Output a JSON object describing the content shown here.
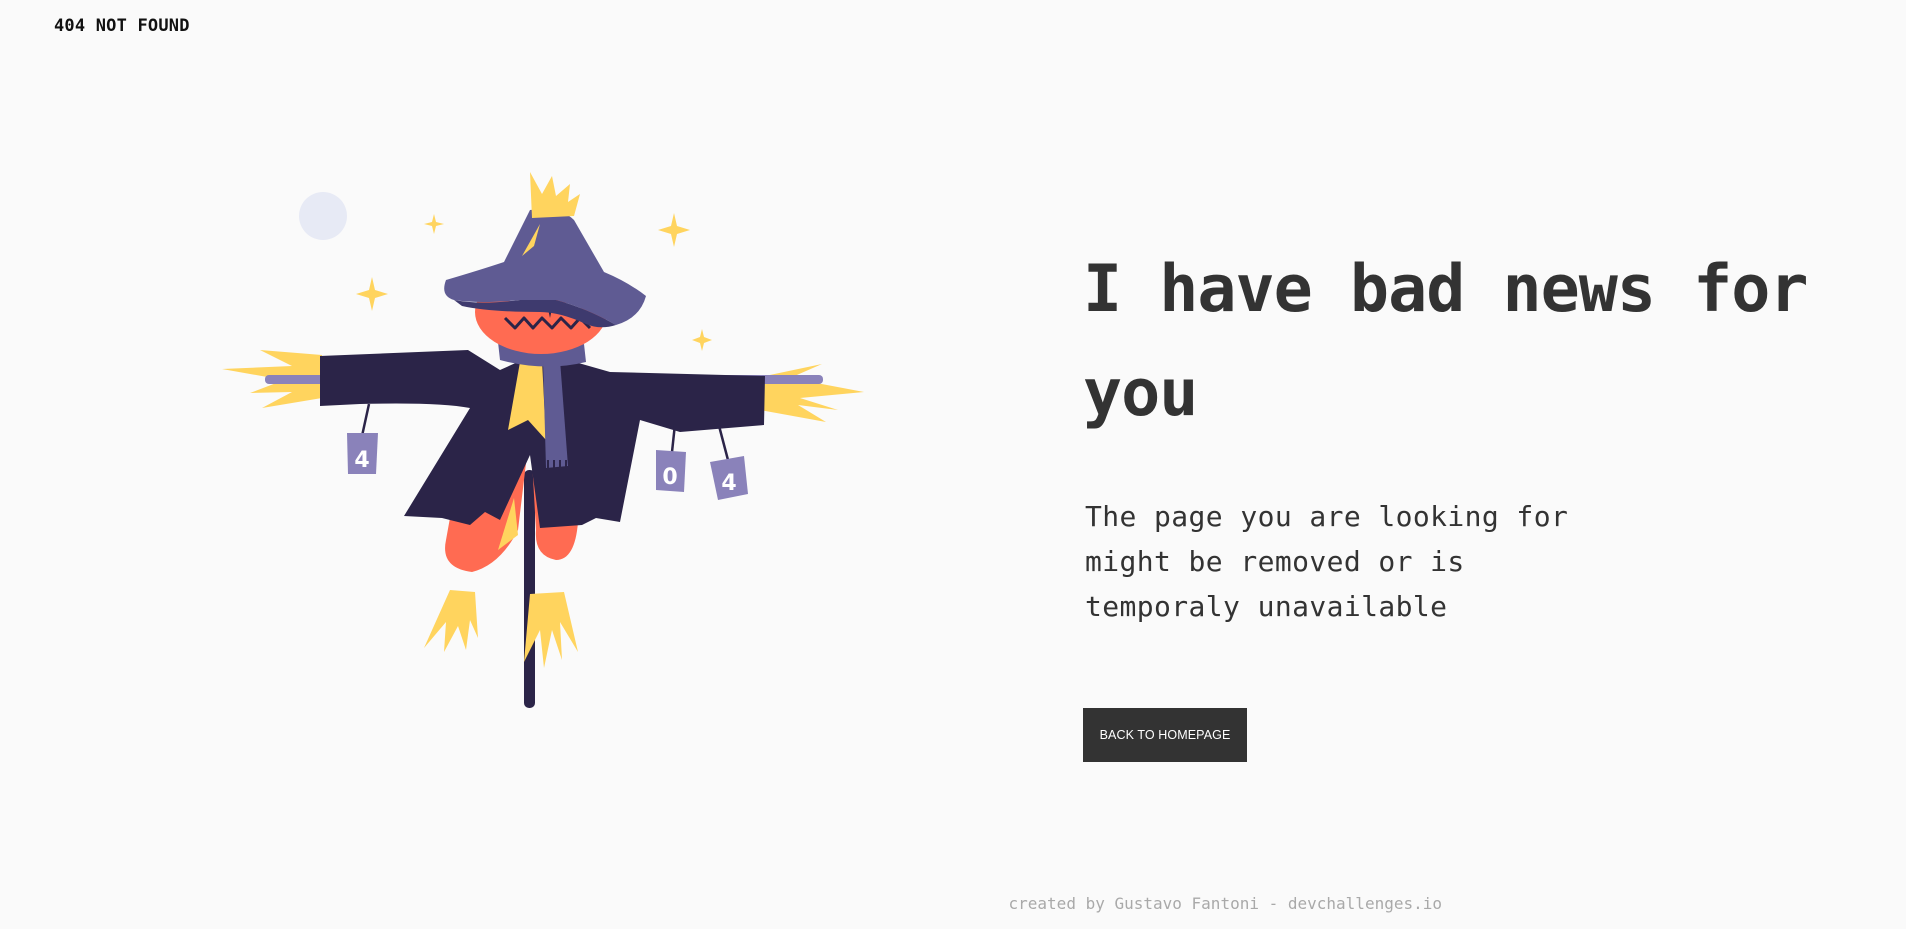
{
  "header": {
    "brand": "404 NOT FOUND"
  },
  "illustration": {
    "name": "scarecrow-illustration",
    "cans": [
      "4",
      "0",
      "4"
    ]
  },
  "main": {
    "headline": "I have bad news for you",
    "message": "The page you are looking for might be removed or is temporaly unavailable",
    "cta_label": "BACK TO HOMEPAGE"
  },
  "footer": {
    "credit_prefix": "created by Gustavo Fantoni - ",
    "credit_link": "devchallenges.io"
  },
  "colors": {
    "background": "#fafafa",
    "text": "#333333",
    "button": "#333333",
    "coat": "#2b2448",
    "hat": "#5f5b93",
    "pumpkin": "#ff6b52",
    "straw": "#ffd45e",
    "moon": "#e7eaf5",
    "footer_text": "#a9a9a9"
  }
}
